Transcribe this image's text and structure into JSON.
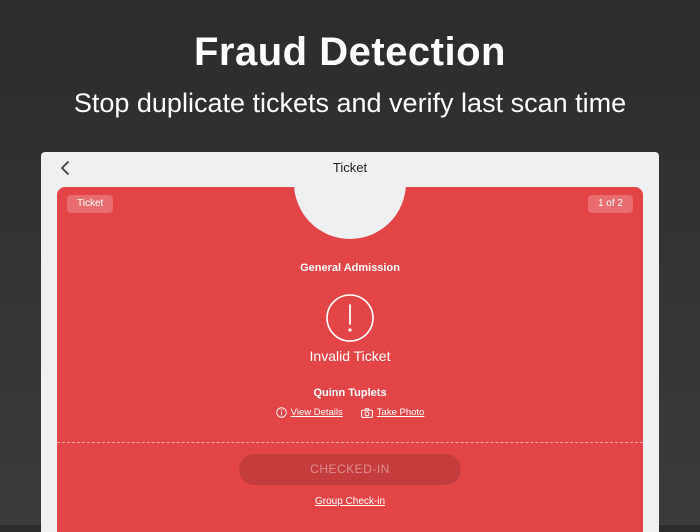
{
  "promo": {
    "headline": "Fraud Detection",
    "subheadline": "Stop duplicate tickets and verify last scan time"
  },
  "navbar": {
    "title": "Ticket",
    "back_icon": "chevron-left-icon"
  },
  "ticket": {
    "type_badge": "Ticket",
    "count_badge": "1 of 2",
    "admission": "General Admission",
    "status_icon": "exclamation-circle-icon",
    "status": "Invalid Ticket",
    "holder_name": "Quinn Tuplets",
    "view_details_icon": "info-icon",
    "view_details_label": "View Details",
    "take_photo_icon": "camera-icon",
    "take_photo_label": "Take Photo",
    "checkin_label": "CHECKED-IN",
    "group_checkin_label": "Group Check-in"
  },
  "colors": {
    "background": "#2f2f2f",
    "card_red": "#e34547",
    "device_bg": "#eff0f2"
  }
}
